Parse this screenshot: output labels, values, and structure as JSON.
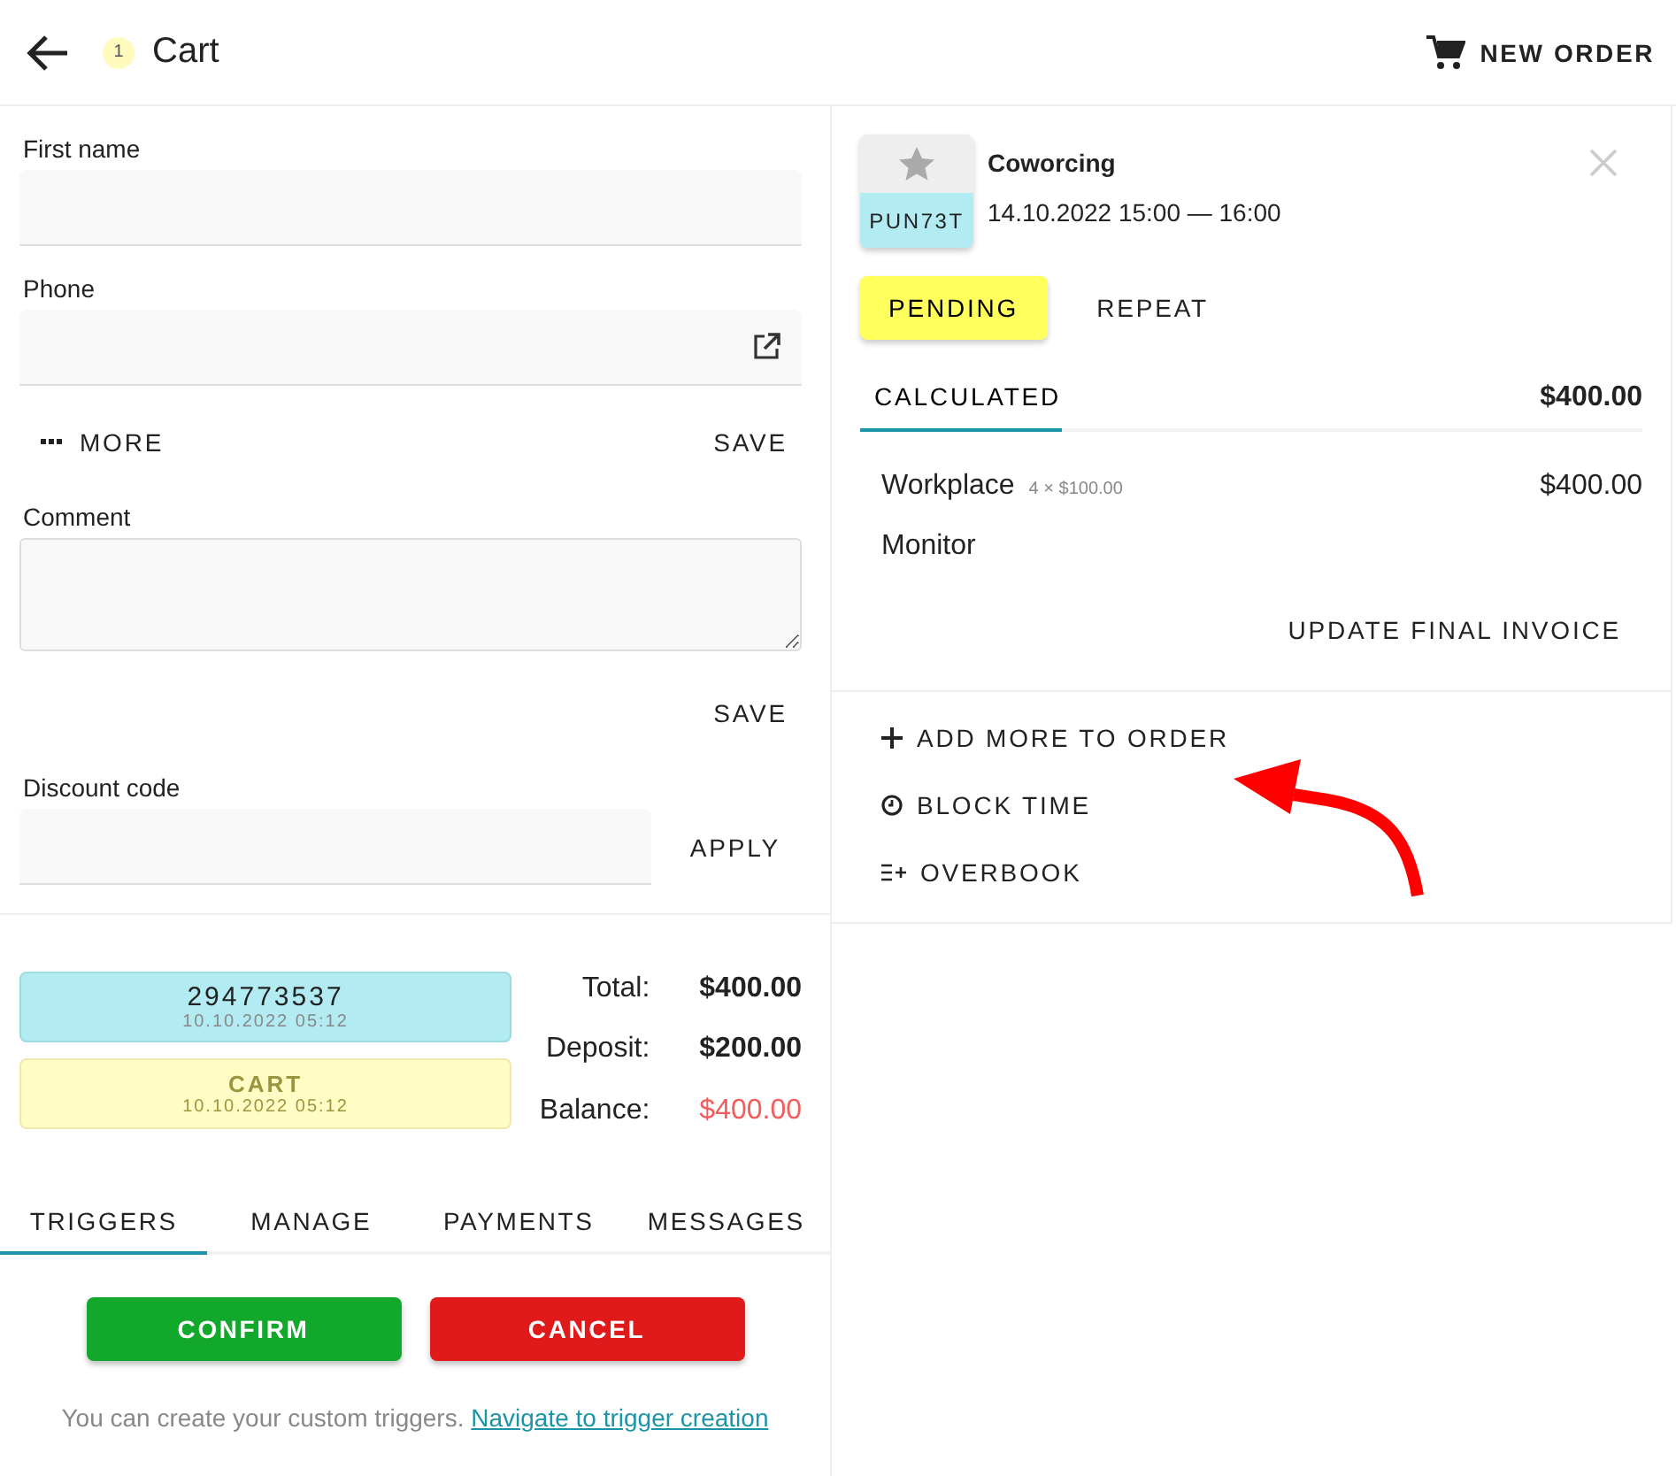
{
  "header": {
    "badge": "1",
    "title": "Cart",
    "action": "NEW ORDER"
  },
  "form": {
    "fields": [
      {
        "label": "First name",
        "kind": "text"
      },
      {
        "label": "Phone",
        "kind": "phone"
      }
    ],
    "more": "MORE",
    "save": "SAVE",
    "comment": {
      "label": "Comment",
      "save": "SAVE"
    },
    "discount": {
      "label": "Discount code",
      "button": "APPLY"
    }
  },
  "statuses": [
    {
      "title": "294773537",
      "time": "10.10.2022 05:12",
      "kind": "number"
    },
    {
      "title": "CART",
      "time": "10.10.2022 05:12",
      "kind": "cart"
    }
  ],
  "totals": [
    {
      "label": "Total:",
      "value": "$400.00",
      "kind": "normal"
    },
    {
      "label": "Deposit:",
      "value": "$200.00",
      "kind": "normal"
    },
    {
      "label": "Balance:",
      "value": "$400.00",
      "kind": "negative"
    }
  ],
  "tabs": [
    {
      "label": "TRIGGERS",
      "selected": true
    },
    {
      "label": "MANAGE",
      "selected": false
    },
    {
      "label": "PAYMENTS",
      "selected": false
    },
    {
      "label": "MESSAGES",
      "selected": false
    }
  ],
  "actions": [
    {
      "label": "CONFIRM",
      "kind": "confirm"
    },
    {
      "label": "CANCEL",
      "kind": "cancel"
    }
  ],
  "hint": {
    "text": "You can create your custom triggers.",
    "link": "Navigate to trigger creation"
  },
  "booking": {
    "code": "PUN73T",
    "title": "Coworcing",
    "time": "14.10.2022 15:00 — 16:00",
    "status": "PENDING",
    "repeat": "REPEAT",
    "tabs": [
      {
        "label": "CALCULATED",
        "selected": true
      }
    ],
    "total": "$400.00",
    "items": [
      {
        "name": "Workplace",
        "detail": "4 × $100.00",
        "price": "$400.00"
      },
      {
        "name": "Monitor"
      }
    ],
    "update": "UPDATE FINAL INVOICE"
  },
  "menu": [
    {
      "label": "ADD MORE TO ORDER",
      "kind": "add"
    },
    {
      "label": "BLOCK TIME",
      "kind": "clock"
    },
    {
      "label": "OVERBOOK",
      "kind": "list-add"
    }
  ]
}
